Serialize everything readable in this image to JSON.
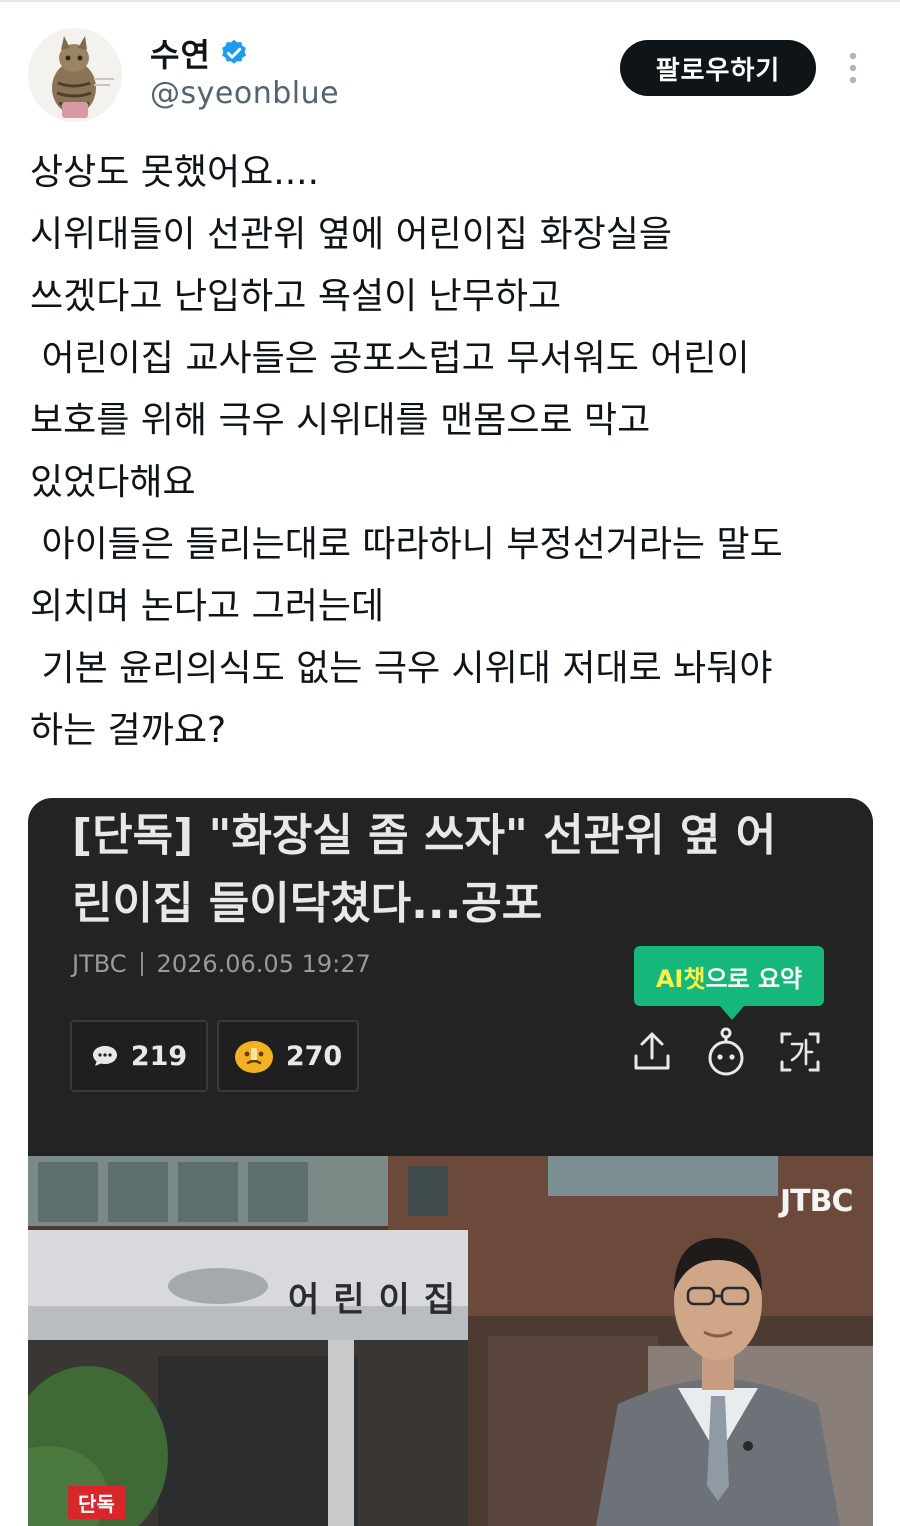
{
  "tweet": {
    "display_name": "수연",
    "handle": "@syeonblue",
    "follow_label": "팔로우하기",
    "lines": [
      "상상도 못했어요....",
      "시위대들이 선관위 옆에 어린이집 화장실을",
      "쓰겠다고 난입하고 욕설이 난무하고",
      " 어린이집 교사들은 공포스럽고 무서워도 어린이",
      "보호를 위해 극우 시위대를 맨몸으로 막고",
      "있었다해요",
      " 아이들은 들리는대로 따라하니 부정선거라는 말도",
      "외치며 논다고 그러는데",
      " 기본 윤리의식도 없는 극우 시위대 저대로 놔둬야",
      "하는 걸까요?"
    ]
  },
  "article": {
    "headline_lines": [
      "[단독] \"화장실 좀 쓰자\" 선관위 옆 어",
      "린이집 들이닥쳤다...공포"
    ],
    "source": "JTBC",
    "datetime": "2026.06.05 19:27",
    "ai_button": {
      "part1": "AI챗",
      "part2": "으로 요약"
    },
    "comments_count": "219",
    "reactions_count": "270",
    "image": {
      "broadcaster_logo": "JTBC",
      "sign_text": "어린이집",
      "badge": "단독"
    }
  },
  "colors": {
    "verified_blue": "#1d9bf0",
    "ai_green": "#15b87a",
    "card_bg": "#232323",
    "badge_red": "#d8262b"
  },
  "icons": [
    "verified-icon",
    "more-icon",
    "comment-icon",
    "reaction-icon",
    "share-icon",
    "ai-bot-icon",
    "font-size-icon"
  ]
}
